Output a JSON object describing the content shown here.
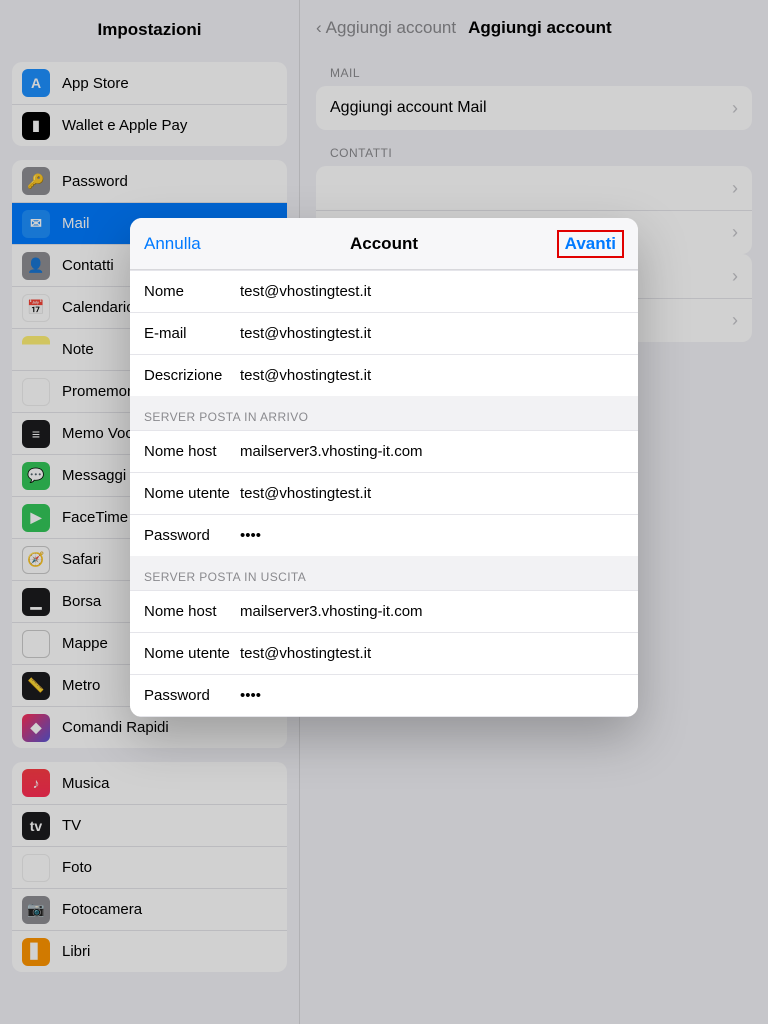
{
  "sidebar": {
    "title": "Impostazioni",
    "groups": [
      [
        {
          "label": "App Store",
          "icon": "ic-appstore",
          "glyph": "A"
        },
        {
          "label": "Wallet e Apple Pay",
          "icon": "ic-wallet",
          "glyph": "▮"
        }
      ],
      [
        {
          "label": "Password",
          "icon": "ic-password",
          "glyph": "🔑"
        },
        {
          "label": "Mail",
          "icon": "ic-mail",
          "glyph": "✉",
          "selected": true
        },
        {
          "label": "Contatti",
          "icon": "ic-contacts",
          "glyph": "👤"
        },
        {
          "label": "Calendario",
          "icon": "ic-calendar",
          "glyph": "📅"
        },
        {
          "label": "Note",
          "icon": "ic-notes",
          "glyph": ""
        },
        {
          "label": "Promemoria",
          "icon": "ic-reminders",
          "glyph": "⋮"
        },
        {
          "label": "Memo Vocali",
          "icon": "ic-memo",
          "glyph": "≡"
        },
        {
          "label": "Messaggi",
          "icon": "ic-messages",
          "glyph": "💬"
        },
        {
          "label": "FaceTime",
          "icon": "ic-facetime",
          "glyph": "▶"
        },
        {
          "label": "Safari",
          "icon": "ic-safari",
          "glyph": "🧭"
        },
        {
          "label": "Borsa",
          "icon": "ic-borsa",
          "glyph": "▁"
        },
        {
          "label": "Mappe",
          "icon": "ic-mappe",
          "glyph": "🗺"
        },
        {
          "label": "Metro",
          "icon": "ic-metro",
          "glyph": "📏"
        },
        {
          "label": "Comandi Rapidi",
          "icon": "ic-comandi",
          "glyph": "◆"
        }
      ],
      [
        {
          "label": "Musica",
          "icon": "ic-musica",
          "glyph": "♪"
        },
        {
          "label": "TV",
          "icon": "ic-tv",
          "glyph": "tv"
        },
        {
          "label": "Foto",
          "icon": "ic-foto",
          "glyph": "✿"
        },
        {
          "label": "Fotocamera",
          "icon": "ic-camera",
          "glyph": "📷"
        },
        {
          "label": "Libri",
          "icon": "ic-libri",
          "glyph": "▋"
        }
      ]
    ]
  },
  "detail": {
    "back": "Aggiungi account",
    "title": "Aggiungi account",
    "sections": [
      {
        "label": "MAIL",
        "rows": [
          {
            "label": "Aggiungi account Mail"
          }
        ]
      },
      {
        "label": "CONTATTI",
        "rows": [
          {
            "label": ""
          },
          {
            "label": ""
          }
        ]
      },
      {
        "label": "",
        "rows": [
          {
            "label": ""
          },
          {
            "label": ""
          }
        ]
      }
    ]
  },
  "modal": {
    "bar": {
      "cancel": "Annulla",
      "title": "Account",
      "next": "Avanti"
    },
    "top": [
      {
        "label": "Nome",
        "value": "test@vhostingtest.it"
      },
      {
        "label": "E-mail",
        "value": "test@vhostingtest.it"
      },
      {
        "label": "Descrizione",
        "value": "test@vhostingtest.it"
      }
    ],
    "in_label": "SERVER POSTA IN ARRIVO",
    "in": [
      {
        "label": "Nome host",
        "value": "mailserver3.vhosting-it.com"
      },
      {
        "label": "Nome utente",
        "value": "test@vhostingtest.it"
      },
      {
        "label": "Password",
        "value": "••••"
      }
    ],
    "out_label": "SERVER POSTA IN USCITA",
    "out": [
      {
        "label": "Nome host",
        "value": "mailserver3.vhosting-it.com"
      },
      {
        "label": "Nome utente",
        "value": "test@vhostingtest.it"
      },
      {
        "label": "Password",
        "value": "••••"
      }
    ]
  }
}
